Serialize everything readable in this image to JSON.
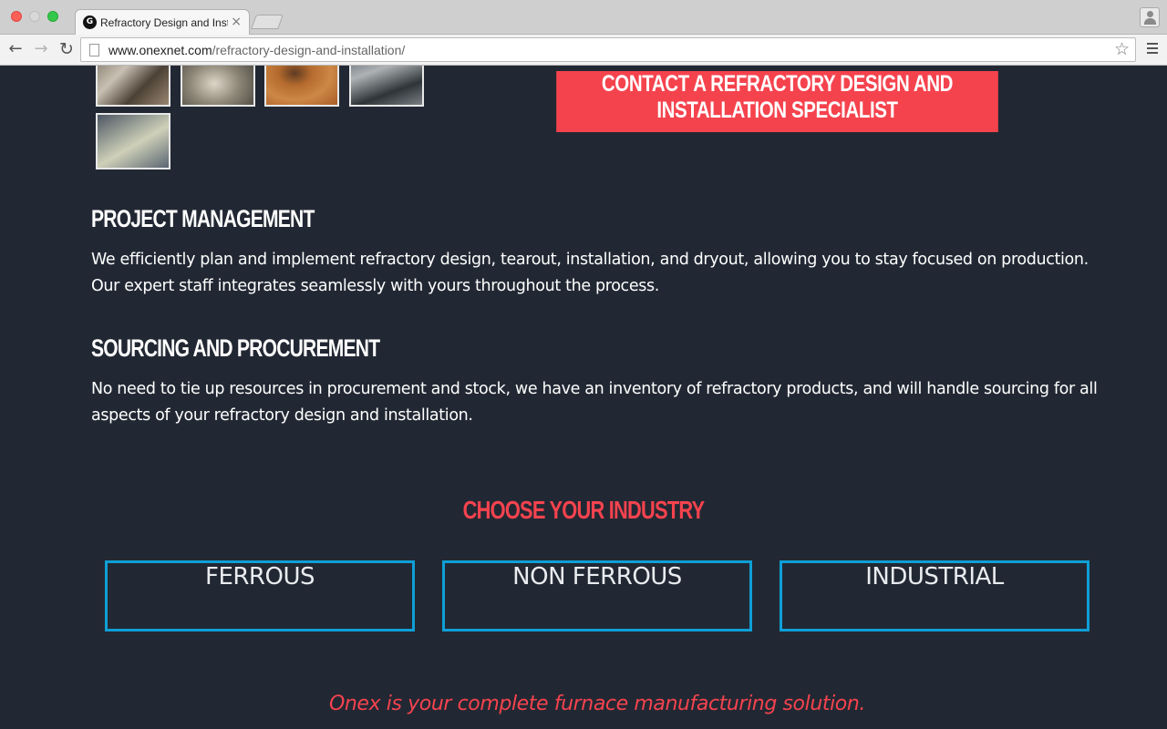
{
  "browser": {
    "tab_favicon": "G",
    "tab_title": "Refractory Design and Installation",
    "tab_close": "×",
    "url_host": "www.onexnet.com",
    "url_path": "/refractory-design-and-installation/",
    "icons": {
      "back": "arrow-left-icon",
      "forward": "arrow-right-icon",
      "reload": "reload-icon",
      "bookmark": "star-icon",
      "menu": "hamburger-menu-icon",
      "profile": "user-profile-icon"
    }
  },
  "gallery": {
    "thumbnails": [
      "thumbnail-1",
      "thumbnail-2",
      "thumbnail-3",
      "thumbnail-4",
      "thumbnail-5"
    ]
  },
  "cta": {
    "label": "CONTACT A REFRACTORY DESIGN AND INSTALLATION SPECIALIST"
  },
  "sections": [
    {
      "heading": "PROJECT MANAGEMENT",
      "body": "We efficiently plan and implement refractory design, tearout, installation, and dryout, allowing you to stay focused on production. Our expert staff integrates seamlessly with yours throughout the process."
    },
    {
      "heading": "SOURCING AND PROCUREMENT",
      "body": "No need to tie up resources in procurement and stock, we have an inventory of refractory products, and will handle sourcing for all aspects of your refractory design and installation."
    }
  ],
  "industry": {
    "heading": "CHOOSE YOUR INDUSTRY",
    "options": [
      "FERROUS",
      "NON FERROUS",
      "INDUSTRIAL"
    ]
  },
  "tagline": "Onex is your complete furnace manufacturing solution.",
  "colors": {
    "page_background": "#222833",
    "accent_red": "#f5434e",
    "industry_border_blue": "#0f9fd6"
  }
}
